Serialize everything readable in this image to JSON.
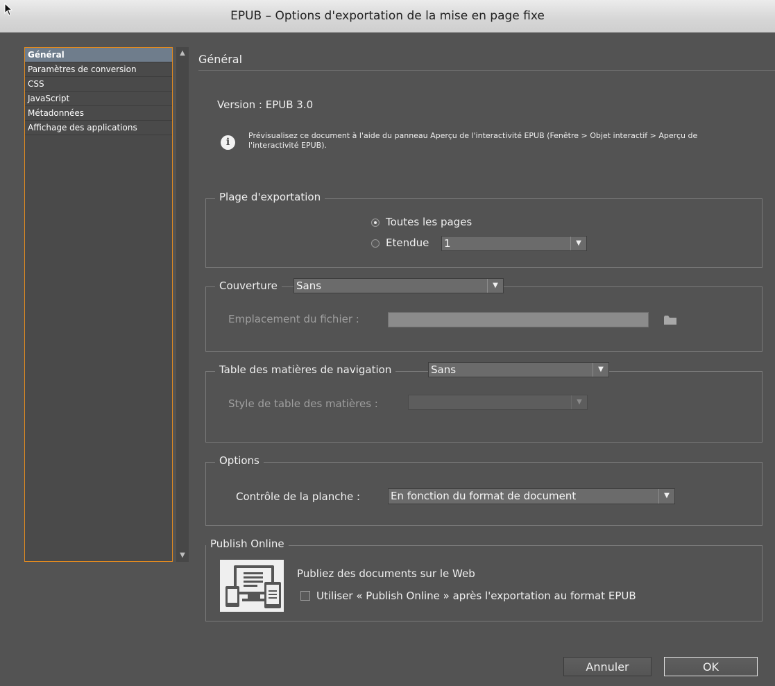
{
  "window": {
    "title": "EPUB – Options d'exportation de la mise en page fixe"
  },
  "sidebar": {
    "items": [
      {
        "label": "Général",
        "selected": true
      },
      {
        "label": "Paramètres de conversion",
        "selected": false
      },
      {
        "label": "CSS",
        "selected": false
      },
      {
        "label": "JavaScript",
        "selected": false
      },
      {
        "label": "Métadonnées",
        "selected": false
      },
      {
        "label": "Affichage des applications",
        "selected": false
      }
    ]
  },
  "main": {
    "header": "Général",
    "version": "Version : EPUB 3.0",
    "info_text": "Prévisualisez ce document à l'aide du panneau Aperçu de l'interactivité EPUB (Fenêtre > Objet interactif > Aperçu de l'interactivité EPUB).",
    "info_icon": "i",
    "export_range": {
      "legend": "Plage d'exportation",
      "all_pages": "Toutes les pages",
      "range": "Etendue",
      "range_value": "1",
      "selected": "all_pages"
    },
    "cover": {
      "legend": "Couverture",
      "value": "Sans",
      "file_location_label": "Emplacement du fichier :"
    },
    "toc": {
      "legend": "Table des matières de navigation",
      "value": "Sans",
      "style_label": "Style de table des matières :"
    },
    "options": {
      "legend": "Options",
      "spread_label": "Contrôle de la planche :",
      "spread_value": "En fonction du format de document"
    },
    "publish": {
      "legend": "Publish Online",
      "heading": "Publiez des documents sur le Web",
      "checkbox_label": "Utiliser « Publish Online » après l'exportation au format EPUB",
      "checked": false
    }
  },
  "buttons": {
    "cancel": "Annuler",
    "ok": "OK"
  },
  "colors": {
    "accent": "#e08a21",
    "background": "#535353",
    "selected": "#6f7d8c"
  },
  "icons": {
    "scroll_up": "▲",
    "scroll_down": "▼",
    "dropdown": "▼"
  }
}
